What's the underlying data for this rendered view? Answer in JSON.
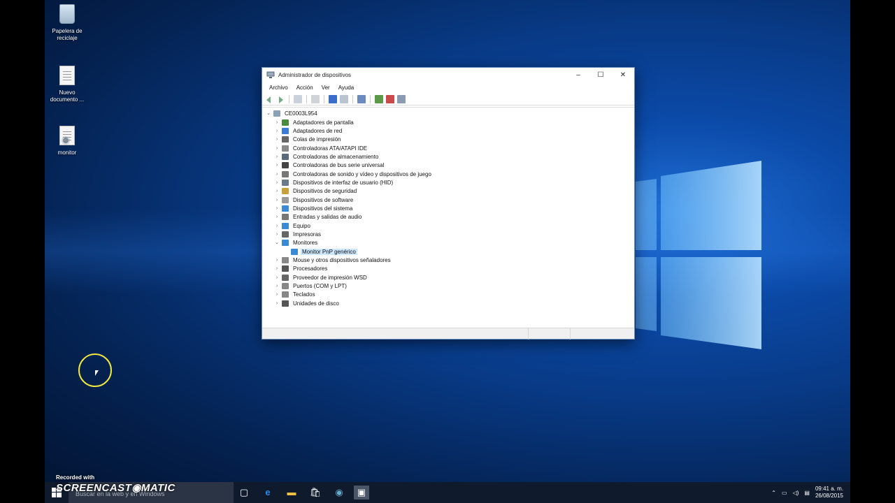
{
  "desktop": {
    "icons": [
      {
        "label": "Papelera de reciclaje",
        "icon": "recycle-bin-icon"
      },
      {
        "label": "Nuevo documento ...",
        "icon": "document-icon"
      },
      {
        "label": "monitor",
        "icon": "settings-file-icon"
      }
    ]
  },
  "window": {
    "title": "Administrador de dispositivos",
    "controls": {
      "minimize": "–",
      "maximize": "☐",
      "close": "✕"
    },
    "menu": [
      "Archivo",
      "Acción",
      "Ver",
      "Ayuda"
    ],
    "tree": {
      "root": "CE0003L954",
      "categories": [
        {
          "label": "Adaptadores de pantalla",
          "color": "#4a8a3c"
        },
        {
          "label": "Adaptadores de red",
          "color": "#3a7bd5"
        },
        {
          "label": "Colas de impresión",
          "color": "#666666"
        },
        {
          "label": "Controladoras ATA/ATAPI IDE",
          "color": "#8a8a8a"
        },
        {
          "label": "Controladoras de almacenamiento",
          "color": "#5a6a7a"
        },
        {
          "label": "Controladoras de bus serie universal",
          "color": "#444444"
        },
        {
          "label": "Controladoras de sonido y vídeo y dispositivos de juego",
          "color": "#777777"
        },
        {
          "label": "Dispositivos de interfaz de usuario (HID)",
          "color": "#6a7a8a"
        },
        {
          "label": "Dispositivos de seguridad",
          "color": "#c8a13a"
        },
        {
          "label": "Dispositivos de software",
          "color": "#9a9a9a"
        },
        {
          "label": "Dispositivos del sistema",
          "color": "#3a8ad5"
        },
        {
          "label": "Entradas y salidas de audio",
          "color": "#777777"
        },
        {
          "label": "Equipo",
          "color": "#3a8ad5"
        },
        {
          "label": "Impresoras",
          "color": "#666666"
        },
        {
          "label": "Monitores",
          "color": "#3a8ad5",
          "expanded": true,
          "children": [
            "Monitor PnP genérico"
          ]
        },
        {
          "label": "Mouse y otros dispositivos señaladores",
          "color": "#888888"
        },
        {
          "label": "Procesadores",
          "color": "#555555"
        },
        {
          "label": "Proveedor de impresión WSD",
          "color": "#666666"
        },
        {
          "label": "Puertos (COM y LPT)",
          "color": "#888888"
        },
        {
          "label": "Teclados",
          "color": "#888888"
        },
        {
          "label": "Unidades de disco",
          "color": "#555555"
        }
      ]
    }
  },
  "taskbar": {
    "search_placeholder": "Buscar en la web y en Windows",
    "clock_time": "09:41 a. m.",
    "clock_date": "26/08/2015"
  },
  "watermark": {
    "line1": "Recorded with",
    "line2": "SCREENCAST◉MATIC"
  }
}
